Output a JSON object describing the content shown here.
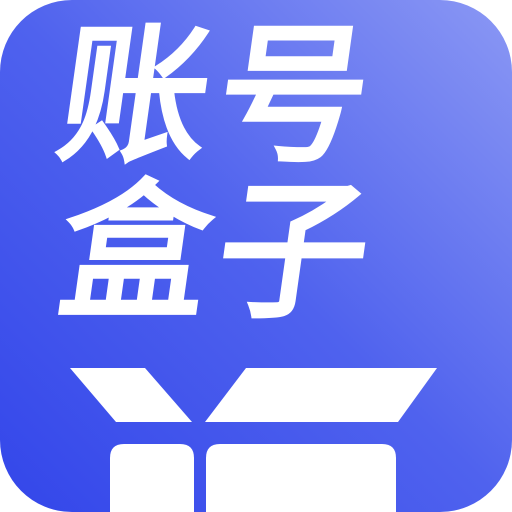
{
  "app_icon": {
    "name_line_1": "账号",
    "name_line_2": "盒子",
    "colors": {
      "gradient_start": "#3346ea",
      "gradient_mid": "#4f62ee",
      "gradient_end": "#8b98f4",
      "glyph": "#ffffff"
    },
    "icon": "open-box-icon"
  }
}
